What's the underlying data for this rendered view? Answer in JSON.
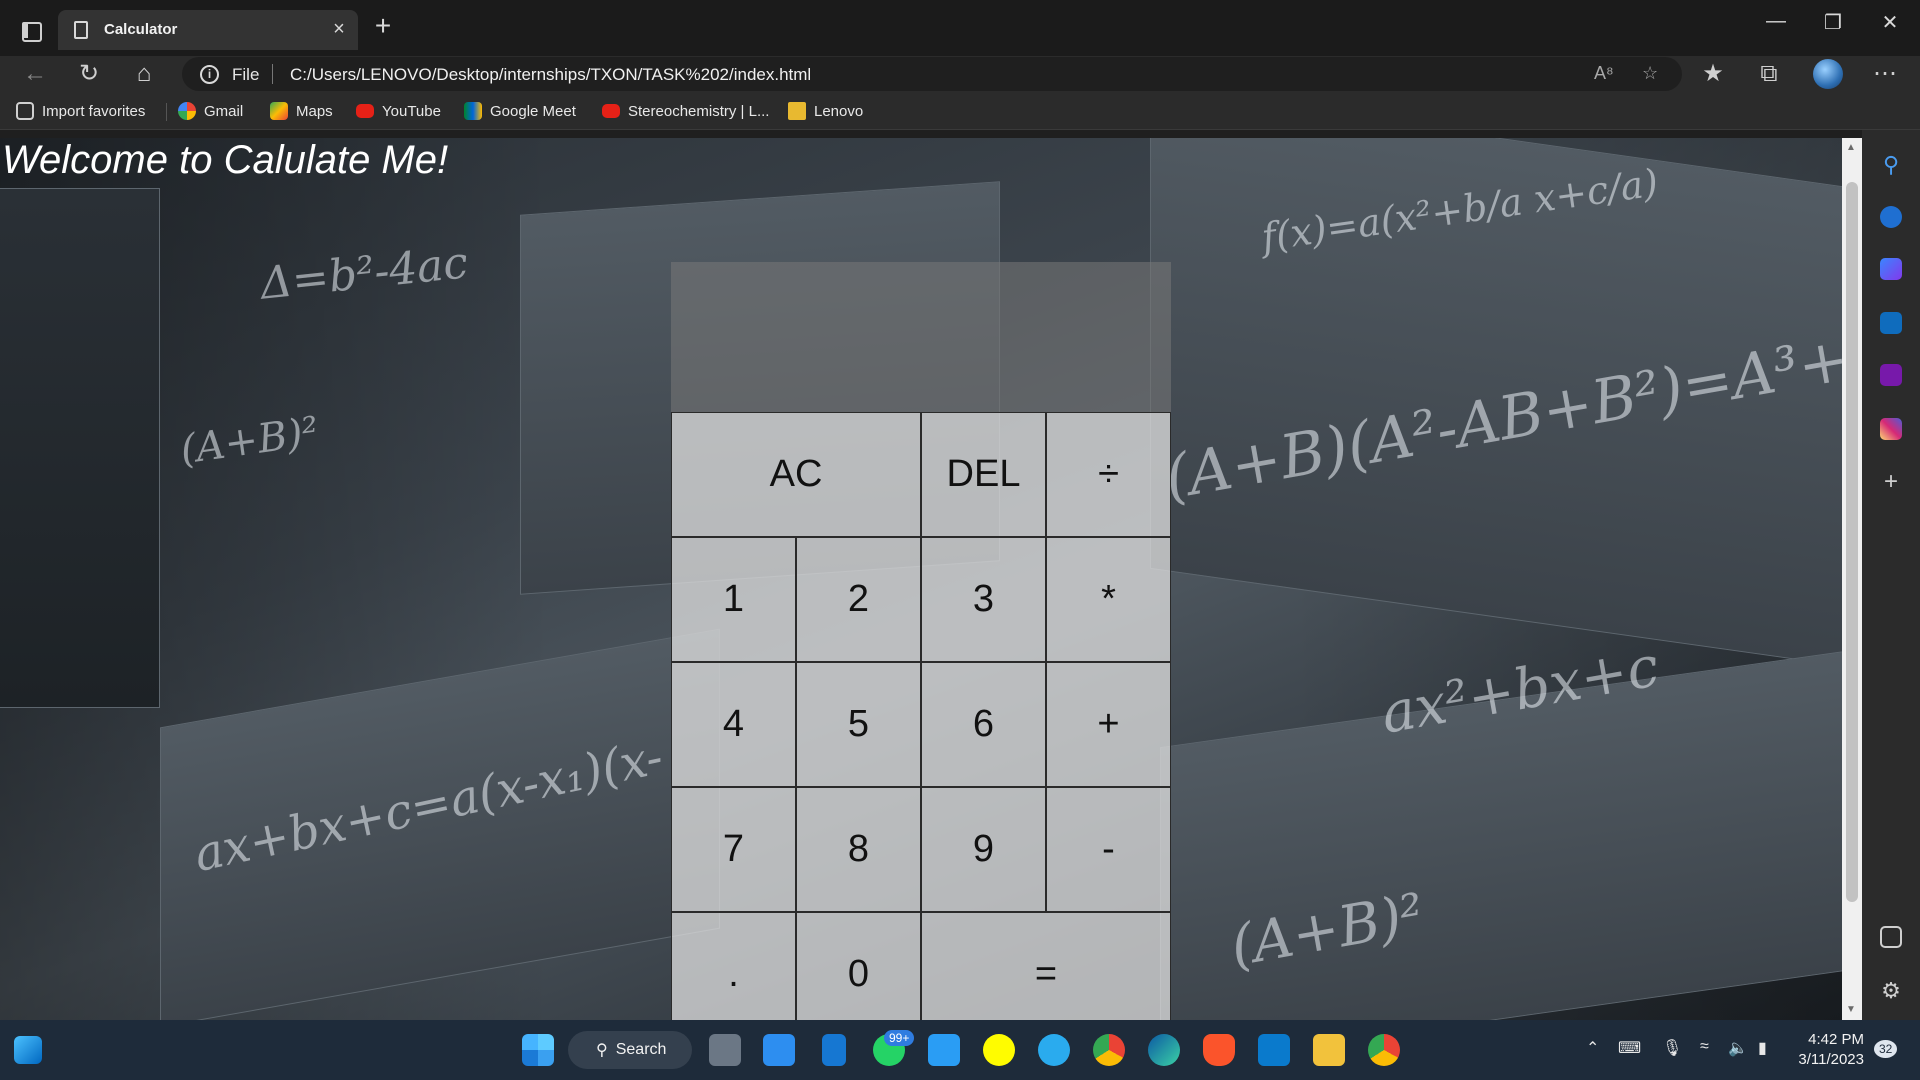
{
  "browser": {
    "tab_title": "Calculator",
    "tab_close": "×",
    "new_tab": "+",
    "address_scheme": "File",
    "address_url": "C:/Users/LENOVO/Desktop/internships/TXON/TASK%202/index.html"
  },
  "bookmarks": [
    {
      "label": "Import favorites",
      "icon": "import-icon"
    },
    {
      "label": "Gmail",
      "icon": "google-icon"
    },
    {
      "label": "Maps",
      "icon": "maps-icon"
    },
    {
      "label": "YouTube",
      "icon": "youtube-icon"
    },
    {
      "label": "Google Meet",
      "icon": "meet-icon"
    },
    {
      "label": "Stereochemistry | L...",
      "icon": "youtube-icon"
    },
    {
      "label": "Lenovo",
      "icon": "folder-icon"
    }
  ],
  "page": {
    "heading": "Welcome to Calulate Me!",
    "display_value": ""
  },
  "keys": [
    {
      "label": "AC",
      "wide": true
    },
    {
      "label": "DEL"
    },
    {
      "label": "÷"
    },
    {
      "label": "1"
    },
    {
      "label": "2"
    },
    {
      "label": "3"
    },
    {
      "label": "*"
    },
    {
      "label": "4"
    },
    {
      "label": "5"
    },
    {
      "label": "6"
    },
    {
      "label": "+"
    },
    {
      "label": "7"
    },
    {
      "label": "8"
    },
    {
      "label": "9"
    },
    {
      "label": "-"
    },
    {
      "label": "."
    },
    {
      "label": "0"
    },
    {
      "label": "=",
      "wide": true
    }
  ],
  "taskbar": {
    "search_label": "Search",
    "whatsapp_badge": "99+",
    "time": "4:42 PM",
    "date": "3/11/2023",
    "notifications": "32"
  },
  "colors": {
    "chrome_bg": "#1b1b1b",
    "key_bg": "#e1e1e1",
    "taskbar_bg": "#1e2b3a"
  }
}
